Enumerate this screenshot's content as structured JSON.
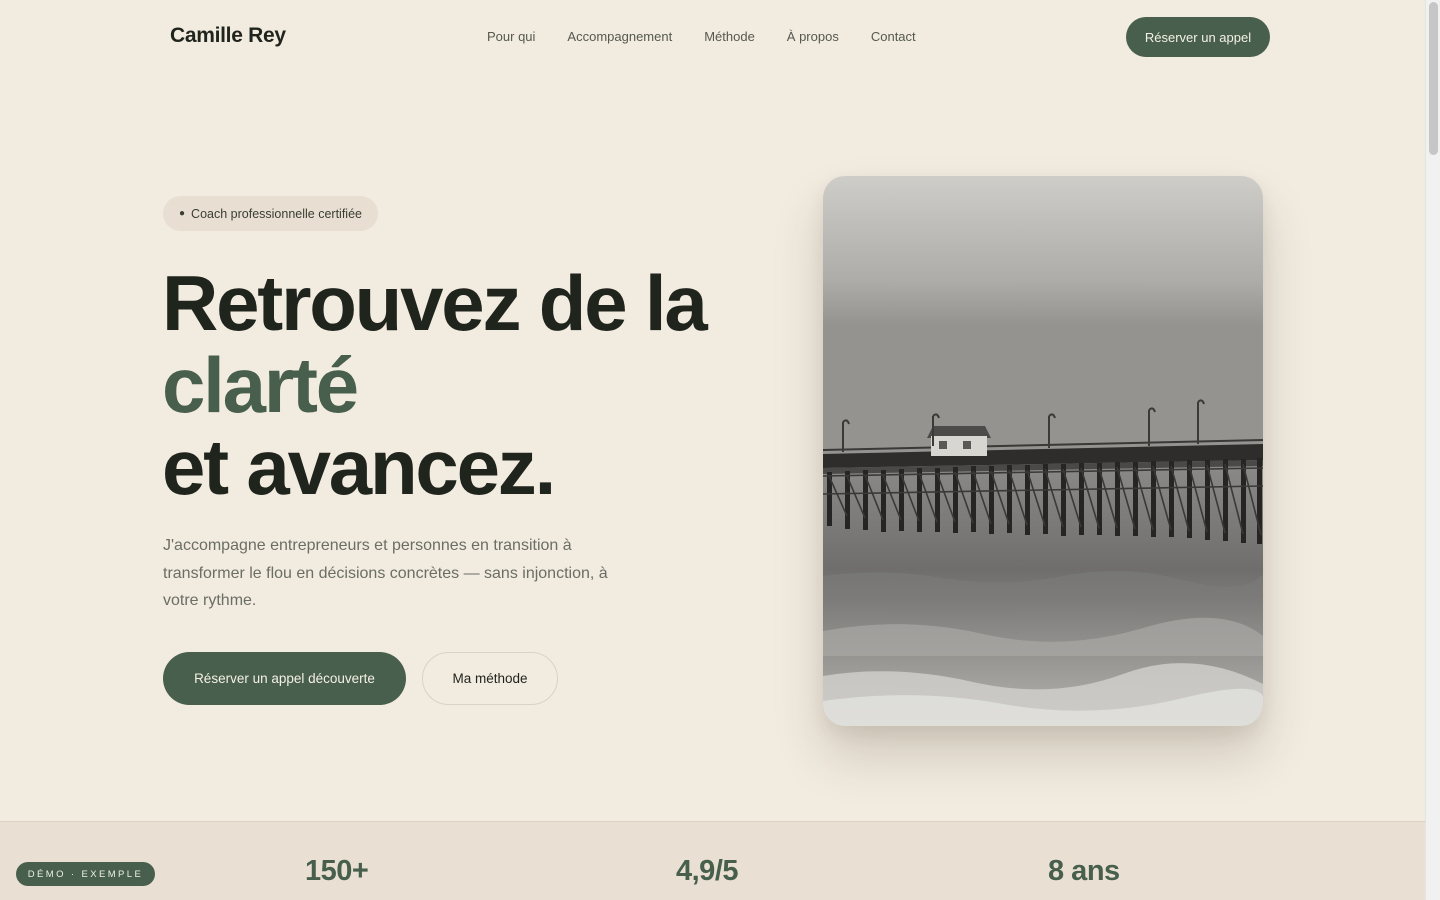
{
  "header": {
    "brand": "Camille Rey",
    "nav": [
      "Pour qui",
      "Accompagnement",
      "Méthode",
      "À propos",
      "Contact"
    ],
    "cta_label": "Réserver un appel"
  },
  "hero": {
    "badge_dot": "●",
    "badge_label": "Coach professionnelle certifiée",
    "headline": {
      "line1": "Retrouvez de la",
      "accent": "clarté",
      "line3": "et avancez."
    },
    "lead": "J'accompagne entrepreneurs et personnes en transition à transformer le flou en décisions concrètes — sans injonction, à votre rythme.",
    "primary_label": "Réserver un appel découverte",
    "secondary_label": "Ma méthode"
  },
  "stats": [
    {
      "value": "150+"
    },
    {
      "value": "4,9/5"
    },
    {
      "value": "8 ans"
    }
  ],
  "demo_label": "DÉMO · EXEMPLE",
  "colors": {
    "background": "#f2ebe0",
    "accent": "#475f4c",
    "text": "#1f241d"
  }
}
